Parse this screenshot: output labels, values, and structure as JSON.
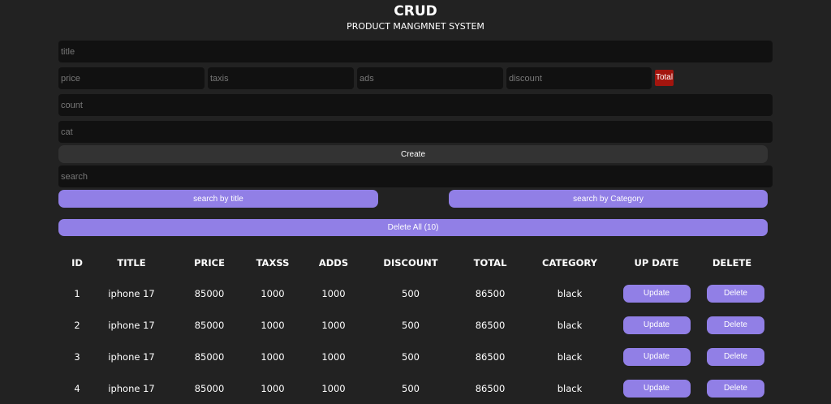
{
  "header": {
    "title": "CRUD",
    "subtitle": "PRODUCT MANGMNET SYSTEM"
  },
  "form": {
    "title_placeholder": "title",
    "price_placeholder": "price",
    "taxes_placeholder": "taxis",
    "ads_placeholder": "ads",
    "discount_placeholder": "discount",
    "total_label": "Total",
    "count_placeholder": "count",
    "category_placeholder": "cat",
    "create_label": "Create"
  },
  "search": {
    "placeholder": "search",
    "by_title_label": "search by title",
    "by_category_label": "search by Category",
    "delete_all_label": "Delete All (10)"
  },
  "table": {
    "headers": [
      "ID",
      "TITLE",
      "PRICE",
      "TAXSS",
      "ADDS",
      "DISCOUNT",
      "TOTAL",
      "CATEGORY",
      "UP DATE",
      "DELETE"
    ],
    "update_label": "Update",
    "delete_label": "Delete",
    "rows": [
      [
        "1",
        "iphone 17",
        "85000",
        "1000",
        "1000",
        "500",
        "86500",
        "black"
      ],
      [
        "2",
        "iphone 17",
        "85000",
        "1000",
        "1000",
        "500",
        "86500",
        "black"
      ],
      [
        "3",
        "iphone 17",
        "85000",
        "1000",
        "1000",
        "500",
        "86500",
        "black"
      ],
      [
        "4",
        "iphone 17",
        "85000",
        "1000",
        "1000",
        "500",
        "86500",
        "black"
      ]
    ]
  },
  "colors": {
    "accent": "#917fe6",
    "total_badge": "#a3150e",
    "background": "#222222",
    "input": "#111111"
  }
}
